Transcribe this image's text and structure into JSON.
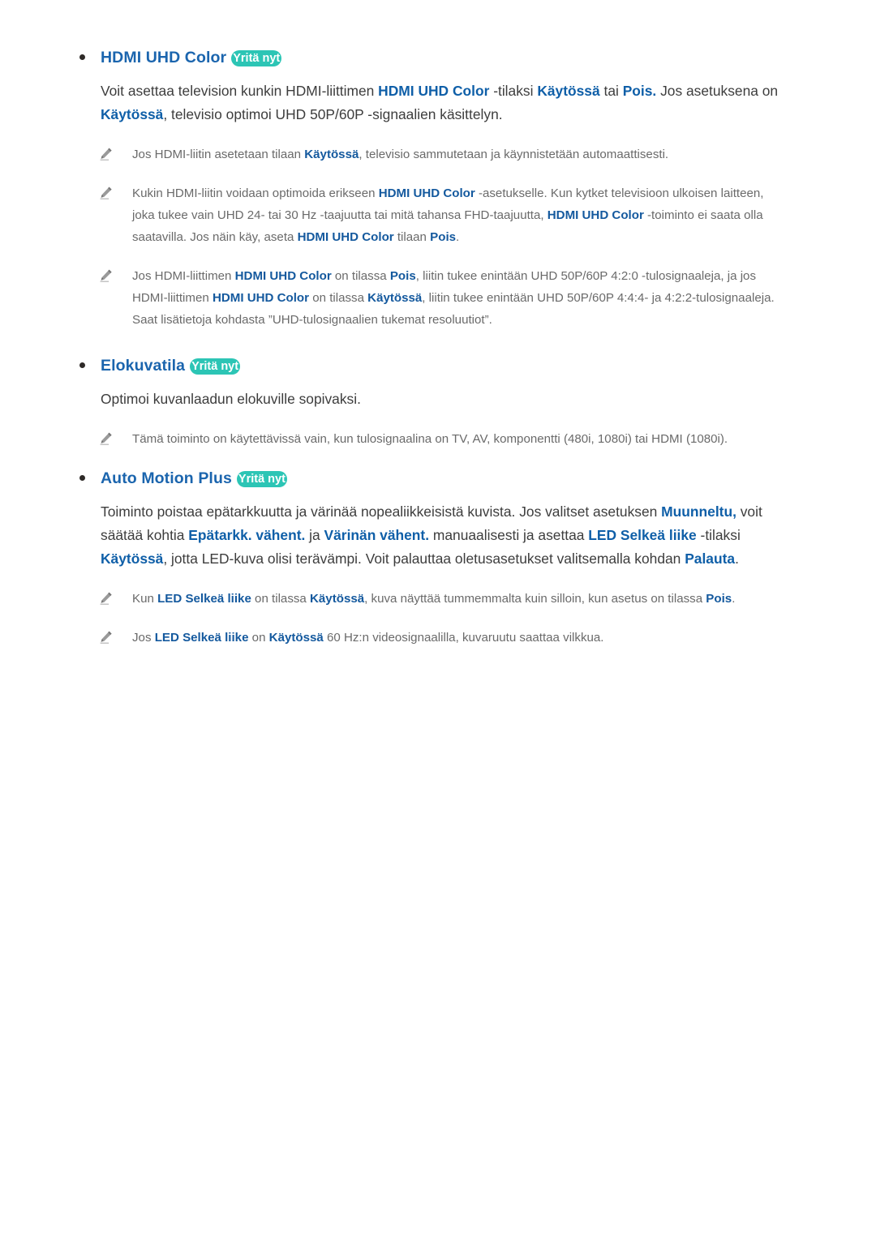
{
  "page": {
    "language": "fi",
    "try_now_label": "Yritä nyt",
    "accent_heading_color": "#1b65ae",
    "accent_inline_color": "#0f5fa8",
    "badge_color": "#2cc5b5",
    "body_color": "#3d3d3d",
    "note_color": "#6a6a6a"
  },
  "sections": [
    {
      "id": "hdmi-uhd-color",
      "title": "HDMI UHD Color",
      "badge": "Yritä nyt",
      "paragraph_html": "Voit asettaa television kunkin HDMI-liittimen <b>HDMI UHD Color</b> -tilaksi <b>Käytössä</b> tai <b>Pois.</b> Jos asetuksena on <b>Käytössä</b>, televisio optimoi UHD 50P/60P -signaalien käsittelyn.",
      "notes": [
        "Jos HDMI-liitin asetetaan tilaan <b>Käytössä</b>, televisio sammutetaan ja käynnistetään automaattisesti.",
        "Kukin HDMI-liitin voidaan optimoida erikseen <b>HDMI UHD Color</b> -asetukselle. Kun kytket televisioon ulkoisen laitteen, joka tukee vain UHD 24- tai 30 Hz -taajuutta tai mitä tahansa FHD-taajuutta, <b>HDMI UHD Color</b> -toiminto ei saata olla saatavilla. Jos näin käy, aseta <b>HDMI UHD Color</b> tilaan <b>Pois</b>.",
        "Jos HDMI-liittimen <b>HDMI UHD Color</b> on tilassa <b>Pois</b>, liitin tukee enintään UHD 50P/60P 4:2:0 -tulosignaaleja, ja jos HDMI-liittimen <b>HDMI UHD Color</b> on tilassa <b>Käytössä</b>, liitin tukee enintään UHD 50P/60P 4:4:4- ja 4:2:2-tulosignaaleja. Saat lisätietoja kohdasta ”UHD-tulosignaalien tukemat resoluutiot”."
      ]
    },
    {
      "id": "elokuvatila",
      "title": "Elokuvatila",
      "badge": "Yritä nyt",
      "paragraph_html": "Optimoi kuvanlaadun elokuville sopivaksi.",
      "notes": [
        "Tämä toiminto on käytettävissä vain, kun tulosignaalina on TV, AV, komponentti (480i, 1080i) tai HDMI (1080i)."
      ]
    },
    {
      "id": "auto-motion-plus",
      "title": "Auto Motion Plus",
      "badge": "Yritä nyt",
      "paragraph_html": "Toiminto poistaa epätarkkuutta ja värinää nopealiikkeisistä kuvista. Jos valitset asetuksen <b>Muunneltu,</b> voit säätää kohtia <b>Epätarkk. vähent.</b> ja <b>Värinän vähent.</b> manuaalisesti ja asettaa <b>LED Selkeä liike</b> -tilaksi <b>Käytössä</b>, jotta LED-kuva olisi terävämpi. Voit palauttaa oletusasetukset valitsemalla kohdan <b>Palauta</b>.",
      "notes": [
        "Kun <b>LED Selkeä liike</b> on tilassa <b>Käytössä</b>, kuva näyttää tummemmalta kuin silloin, kun asetus on tilassa <b>Pois</b>.",
        "Jos <b>LED Selkeä liike</b> on <b>Käytössä</b> 60 Hz:n videosignaalilla, kuvaruutu saattaa vilkkua."
      ]
    }
  ]
}
